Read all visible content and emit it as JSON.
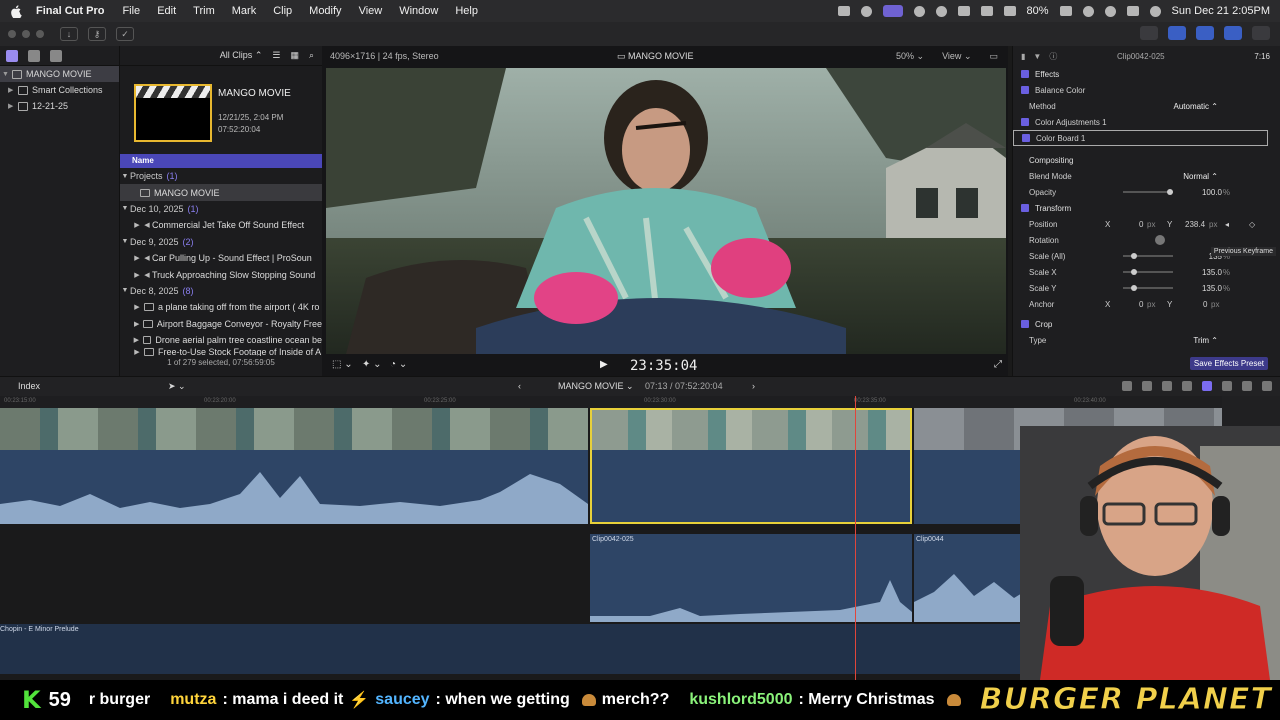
{
  "menubar": {
    "app_name": "Final Cut Pro",
    "items": [
      "File",
      "Edit",
      "Trim",
      "Mark",
      "Clip",
      "Modify",
      "View",
      "Window",
      "Help"
    ],
    "battery": "80%",
    "datetime": "Sun Dec 21  2:05PM"
  },
  "library": {
    "name": "MANGO MOVIE",
    "items": [
      {
        "label": "Smart Collections"
      },
      {
        "label": "12-21-25"
      }
    ]
  },
  "browser": {
    "filter": "All Clips",
    "project_title": "MANGO MOVIE",
    "project_date": "12/21/25, 2:04 PM",
    "project_duration": "07:52:20:04",
    "column_name": "Name",
    "groups": [
      {
        "label": "Projects",
        "count": "(1)",
        "items": [
          "MANGO MOVIE"
        ]
      },
      {
        "label": "Dec 10, 2025",
        "count": "(1)",
        "items": [
          "Commercial Jet Take Off Sound Effect"
        ]
      },
      {
        "label": "Dec 9, 2025",
        "count": "(2)",
        "items": [
          "Car Pulling Up - Sound Effect  |  ProSoun",
          "Truck Approaching Slow Stopping Sound"
        ]
      },
      {
        "label": "Dec 8, 2025",
        "count": "(8)",
        "items": [
          "a plane taking off from the airport ( 4K ro",
          "Airport Baggage Conveyor - Royalty Free",
          "Drone aerial palm tree coastline ocean be",
          "Free-to-Use Stock Footage of Inside of A"
        ]
      }
    ],
    "footer": "1 of 279 selected, 07:56:59:05"
  },
  "viewer": {
    "format": "4096×1716 | 24 fps, Stereo",
    "title": "MANGO MOVIE",
    "zoom": "50%",
    "view_label": "View",
    "timecode": "23:35:04"
  },
  "inspector": {
    "clip_name": "Clip0042-025",
    "duration": "7:16",
    "effects_label": "Effects",
    "balance_color": "Balance Color",
    "method_label": "Method",
    "method_value": "Automatic",
    "color_adjust": "Color Adjustments 1",
    "color_board": "Color Board 1",
    "compositing": "Compositing",
    "blend_label": "Blend Mode",
    "blend_value": "Normal",
    "opacity_label": "Opacity",
    "opacity_value": "100.0",
    "opacity_unit": "%",
    "transform": "Transform",
    "position_label": "Position",
    "pos_x_label": "X",
    "pos_x": "0",
    "pos_y_label": "Y",
    "pos_y": "238.4",
    "px_unit": "px",
    "rotation_label": "Rotation",
    "scale_all_label": "Scale (All)",
    "scale_all": "135",
    "scale_x_label": "Scale X",
    "scale_x": "135.0",
    "scale_y_label": "Scale Y",
    "scale_y": "135.0",
    "anchor_label": "Anchor",
    "anchor_x": "0",
    "anchor_y": "0",
    "crop": "Crop",
    "type_label": "Type",
    "type_value": "Trim",
    "tooltip": "Previous Keyframe",
    "save_preset": "Save Effects Preset"
  },
  "timeline": {
    "index_label": "Index",
    "project": "MANGO MOVIE",
    "position": "07:13 / 07:52:20:04",
    "clip_a": "Clip0042-025",
    "clip_b": "Clip0044",
    "music": "Chopin - E Minor Prelude"
  },
  "ticker": {
    "k_label": "K",
    "k_count": "59",
    "messages": [
      {
        "user": "",
        "text": "r burger"
      },
      {
        "user": "mutza",
        "text": ": mama i deed it"
      },
      {
        "user": "saucey",
        "text": ": when we getting"
      },
      {
        "user": "",
        "text": "merch??"
      },
      {
        "user": "kushlord5000",
        "text": ": Merry Christmas"
      }
    ],
    "brand": "BURGER PLANET"
  },
  "colors": {
    "accent": "#6a5fe0",
    "selection_yellow": "#e8d13a",
    "playhead": "#e0463b",
    "audio_blue": "#2e4566"
  }
}
